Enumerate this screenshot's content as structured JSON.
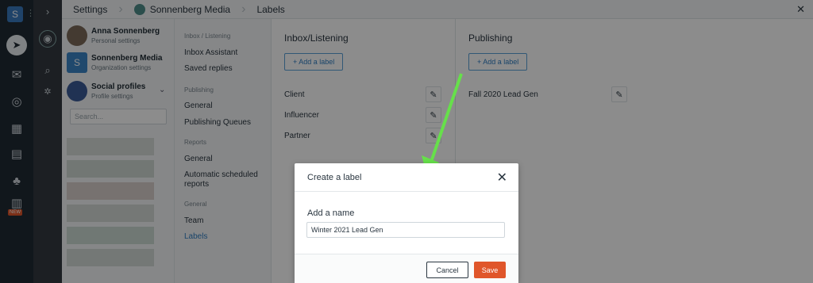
{
  "rail": {
    "logo": "S",
    "new_badge": "NEW"
  },
  "topbar": {
    "crumb_settings": "Settings",
    "crumb_org": "Sonnenberg Media",
    "crumb_labels": "Labels"
  },
  "accounts": [
    {
      "name": "Anna Sonnenberg",
      "sub": "Personal settings"
    },
    {
      "name": "Sonnenberg Media",
      "sub": "Organization settings",
      "initial": "S"
    },
    {
      "name": "Social profiles",
      "sub": "Profile settings"
    }
  ],
  "search": {
    "placeholder": "Search..."
  },
  "nav": {
    "inbox_group": "Inbox / Listening",
    "inbox_assistant": "Inbox Assistant",
    "saved_replies": "Saved replies",
    "publishing_group": "Publishing",
    "publishing_general": "General",
    "publishing_queues": "Publishing Queues",
    "reports_group": "Reports",
    "reports_general": "General",
    "automatic_reports": "Automatic scheduled reports",
    "general_group": "General",
    "team": "Team",
    "labels": "Labels"
  },
  "inbox_panel": {
    "title": "Inbox/Listening",
    "add_label": "+ Add a label",
    "labels": [
      "Client",
      "Influencer",
      "Partner"
    ]
  },
  "publishing_panel": {
    "title": "Publishing",
    "add_label": "+ Add a label",
    "labels": [
      "Fall 2020 Lead Gen"
    ]
  },
  "modal": {
    "title": "Create a label",
    "field_label": "Add a name",
    "field_value": "Winter 2021 Lead Gen",
    "cancel": "Cancel",
    "save": "Save"
  },
  "colors": {
    "accent": "#2f7dc1",
    "save": "#e0562a",
    "arrow": "#66e04a"
  }
}
